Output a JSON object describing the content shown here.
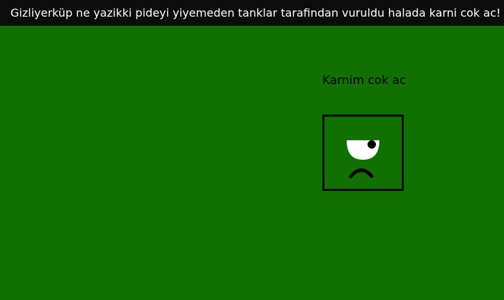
{
  "banner": {
    "message": "Gizliyerküp ne yazikki pideyi yiyemeden tanklar tarafindan vuruldu halada karni cok ac!"
  },
  "character": {
    "status_text": "Karnim cok ac",
    "mood": "sad",
    "icon": "one-eyed-sad-face-icon"
  },
  "colors": {
    "background": "#107000",
    "banner_background": "#0c0c0c",
    "banner_text": "#ffffff",
    "face_outline": "#000000",
    "eye_white": "#ffffff"
  }
}
